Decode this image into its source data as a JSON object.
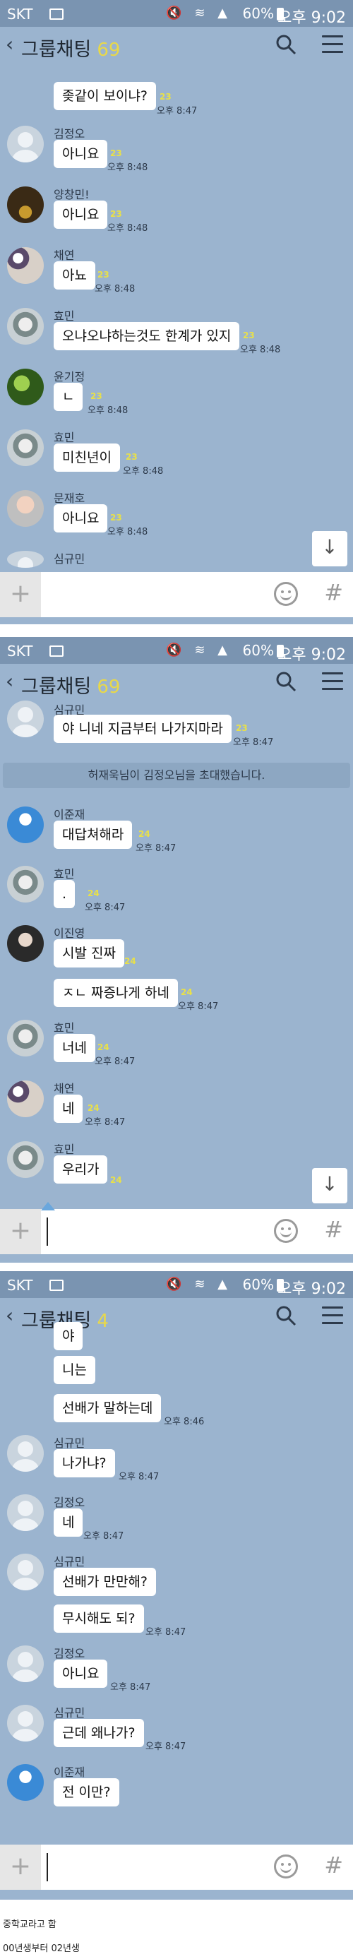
{
  "status": {
    "carrier": "SKT",
    "battery": "60%",
    "time": "오후 9:02"
  },
  "screens": [
    {
      "title": "그룹채팅",
      "count": "69",
      "messages": [
        {
          "bubble": "좆같이 보이냐?",
          "unread": "23",
          "time": "오후 8:47"
        },
        {
          "name": "김정오",
          "bubble": "아니요",
          "unread": "23",
          "time": "오후 8:48"
        },
        {
          "name": "양창민!",
          "bubble": "아니요",
          "unread": "23",
          "time": "오후 8:48"
        },
        {
          "name": "채연",
          "bubble": "아뇨",
          "unread": "23",
          "time": "오후 8:48"
        },
        {
          "name": "효민",
          "bubble": "오냐오냐하는것도 한계가 있지",
          "unread": "23",
          "time": "오후 8:48"
        },
        {
          "name": "윤기정",
          "bubble": "ㄴ",
          "unread": "23",
          "time": "오후 8:48"
        },
        {
          "name": "효민",
          "bubble": "미친년이",
          "unread": "23",
          "time": "오후 8:48"
        },
        {
          "name": "문재호",
          "bubble": "아니요",
          "unread": "23",
          "time": "오후 8:48"
        },
        {
          "name": "심규민"
        }
      ]
    },
    {
      "title": "그룹채팅",
      "count": "69",
      "messages": [
        {
          "name": "심규민",
          "bubble": "야 니네 지금부터 나가지마라",
          "unread": "23",
          "time": "오후 8:47"
        },
        {
          "name": "이준재",
          "bubble": "대답쳐해라",
          "unread": "24",
          "time": "오후 8:47"
        },
        {
          "name": "효민",
          "bubble": ".",
          "unread": "24",
          "time": "오후 8:47"
        },
        {
          "name": "이진영",
          "bubble": "시발 진짜",
          "unread": "24"
        },
        {
          "bubble": "ㅈㄴ 짜증나게 하네",
          "unread": "24",
          "time": "오후 8:47"
        },
        {
          "name": "효민",
          "bubble": "너네",
          "unread": "24",
          "time": "오후 8:47"
        },
        {
          "name": "채연",
          "bubble": "네",
          "unread": "24",
          "time": "오후 8:47"
        },
        {
          "name": "효민",
          "bubble": "우리가",
          "unread": "24"
        }
      ],
      "notice": "허재욱님이 김정오님을 초대했습니다."
    },
    {
      "title": "그룹채팅",
      "count": "4",
      "messages": [
        {
          "bubble": "야"
        },
        {
          "bubble": "니는"
        },
        {
          "bubble": "선배가 말하는데",
          "time": "오후 8:46"
        },
        {
          "name": "심규민",
          "bubble": "나가냐?",
          "time": "오후 8:47"
        },
        {
          "name": "김정오",
          "bubble": "네",
          "time": "오후 8:47"
        },
        {
          "name": "심규민",
          "bubble": "선배가 만만해?"
        },
        {
          "bubble": "무시해도 되?",
          "time": "오후 8:47"
        },
        {
          "name": "김정오",
          "bubble": "아니요",
          "time": "오후 8:47"
        },
        {
          "name": "심규민",
          "bubble": "근데 왜나가?",
          "time": "오후 8:47"
        },
        {
          "name": "이준재",
          "bubble": "전 이만?"
        }
      ]
    }
  ],
  "captions": [
    "중학교라고 함",
    "00년생부터 02년생"
  ],
  "icons": {
    "back": "chevron-left-icon",
    "search": "search-icon",
    "menu": "menu-icon",
    "plus": "plus-icon",
    "emoji": "emoji-icon",
    "hash": "hash-icon",
    "scroll": "arrow-down-icon"
  }
}
